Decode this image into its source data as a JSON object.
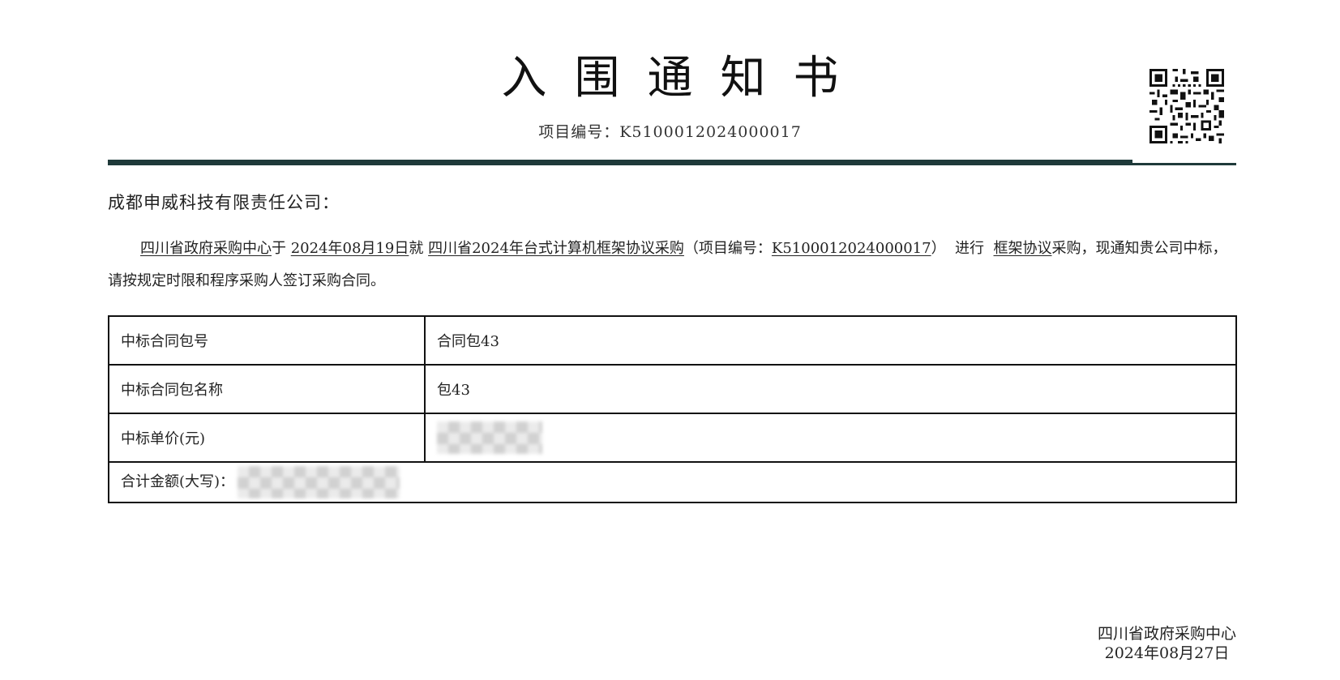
{
  "document": {
    "title": "入围通知书",
    "project_number_line": "项目编号：K5100012024000017",
    "addressee": "成都申威科技有限责任公司：",
    "body": {
      "agency": "四川省政府采购中心",
      "text_yu": "于",
      "date": "2024年08月19日",
      "text_jiu": "就",
      "project_name": "四川省2024年台式计算机框架协议采购",
      "text_paren_open": "（项目编号：",
      "project_number": "K5100012024000017",
      "text_paren_close": "）",
      "text_jinxing": "进行",
      "method": "框架协议",
      "text_tail": "采购，现通知贵公司中标，请按规定时限和程序采购人签订采购合同。"
    },
    "table": {
      "rows": [
        {
          "label": "中标合同包号",
          "value": "合同包43"
        },
        {
          "label": "中标合同包名称",
          "value": "包43"
        },
        {
          "label": "中标单价(元)",
          "value": ""
        }
      ],
      "total_label": "合计金额(大写)："
    },
    "signature": {
      "org": "四川省政府采购中心",
      "date": "2024年08月27日"
    }
  },
  "icons": {
    "qr": "qr-code-icon"
  },
  "colors": {
    "rule": "#1f3a3a",
    "text": "#222222"
  }
}
